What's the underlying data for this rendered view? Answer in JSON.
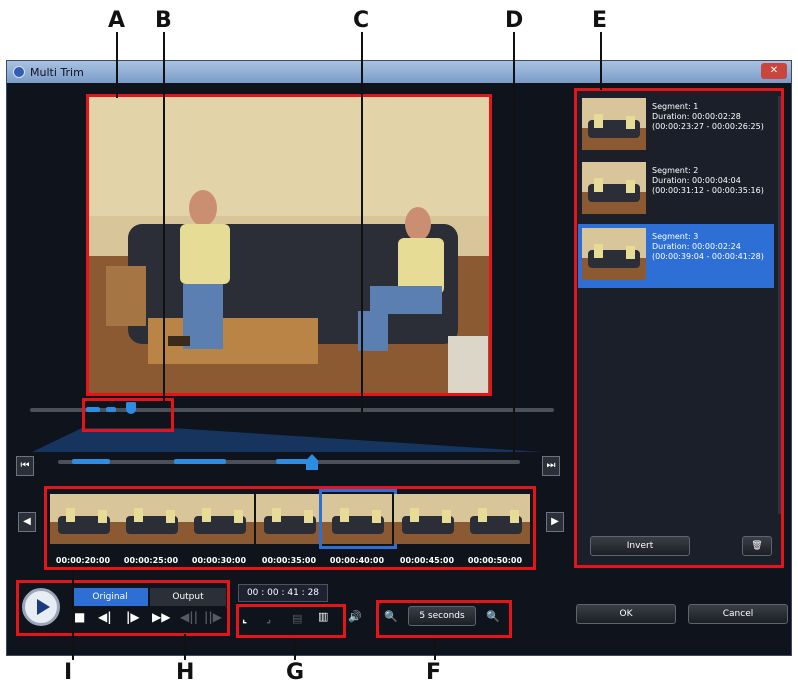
{
  "callouts": {
    "A": "A",
    "B": "B",
    "C": "C",
    "D": "D",
    "E": "E",
    "F": "F",
    "G": "G",
    "H": "H",
    "I": "I"
  },
  "window": {
    "title": "Multi Trim",
    "close_icon": "close-icon",
    "app_icon": "app-icon"
  },
  "timeline": {
    "ticks": [
      "00:00:20:00",
      "00:00:25:00",
      "00:00:30:00",
      "00:00:35:00",
      "00:00:40:00",
      "00:00:45:00",
      "00:00:50:00"
    ],
    "selected_frame_index": 4
  },
  "segments": [
    {
      "title": "Segment: 1",
      "duration": "Duration: 00:00:02:28",
      "range": "(00:00:23:27 - 00:00:26:25)",
      "selected": false
    },
    {
      "title": "Segment: 2",
      "duration": "Duration: 00:00:04:04",
      "range": "(00:00:31:12 - 00:00:35:16)",
      "selected": false
    },
    {
      "title": "Segment: 3",
      "duration": "Duration: 00:00:02:24",
      "range": "(00:00:39:04 - 00:00:41:28)",
      "selected": true
    }
  ],
  "segment_panel": {
    "invert_label": "Invert",
    "delete_icon": "trash-icon"
  },
  "playback": {
    "tab_original": "Original",
    "tab_output": "Output",
    "active_tab": "Original",
    "timecode": "00 : 00 : 41 : 28",
    "icons": [
      "play-icon",
      "stop-icon",
      "previous-frame-icon",
      "next-frame-icon",
      "fast-forward-icon",
      "jump-start-icon",
      "jump-end-icon"
    ]
  },
  "zoom": {
    "label": "5 seconds",
    "zoom_out_icon": "zoom-out-icon",
    "zoom_in_icon": "zoom-in-icon"
  },
  "buttons": {
    "ok": "OK",
    "cancel": "Cancel"
  },
  "colors": {
    "highlight": "#e3151b",
    "selection": "#2e6fd6",
    "accent": "#2d8de0",
    "window_bg": "#0f131b"
  }
}
